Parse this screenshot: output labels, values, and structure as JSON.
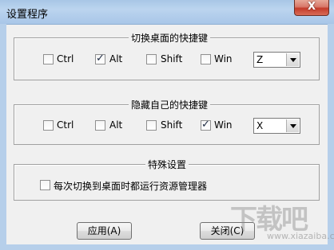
{
  "window": {
    "title": "设置程序",
    "close_label": "X"
  },
  "groups": [
    {
      "legend": "切换桌面的快捷键",
      "checkboxes": [
        {
          "label": "Ctrl",
          "checked": false
        },
        {
          "label": "Alt",
          "checked": true
        },
        {
          "label": "Shift",
          "checked": false
        },
        {
          "label": "Win",
          "checked": false
        }
      ],
      "key": "Z"
    },
    {
      "legend": "隐藏自己的快捷键",
      "checkboxes": [
        {
          "label": "Ctrl",
          "checked": false
        },
        {
          "label": "Alt",
          "checked": false
        },
        {
          "label": "Shift",
          "checked": false
        },
        {
          "label": "Win",
          "checked": true
        }
      ],
      "key": "X"
    },
    {
      "legend": "特殊设置",
      "checkboxes": [
        {
          "label": "每次切换到桌面时都运行资源管理器",
          "checked": false
        }
      ]
    }
  ],
  "buttons": {
    "apply": "应用(A)",
    "close": "关闭(C)"
  },
  "watermark": {
    "big": "下载吧",
    "small": "www.xiazaiba.com"
  }
}
